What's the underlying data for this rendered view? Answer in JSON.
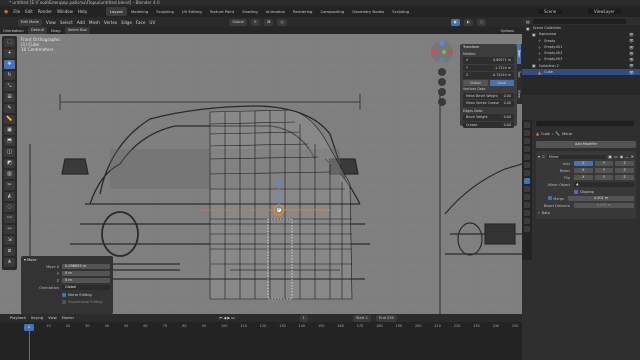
{
  "window": {
    "title": "* untitled [E:\\Гной\\Блендер работы\\Порш\\untitled.blend] - Blender 4.0"
  },
  "menubar": {
    "items": [
      "File",
      "Edit",
      "Render",
      "Window",
      "Help"
    ],
    "workspaces": [
      "Layout",
      "Modeling",
      "Sculpting",
      "UV Editing",
      "Texture Paint",
      "Shading",
      "Animation",
      "Rendering",
      "Compositing",
      "Geometry Nodes",
      "Scripting"
    ],
    "active_workspace": "Layout",
    "scene": "Scene",
    "view_layer": "ViewLayer"
  },
  "viewport_header": {
    "mode": "Edit Mode",
    "menus": [
      "View",
      "Select",
      "Add",
      "Mesh",
      "Vertex",
      "Edge",
      "Face",
      "UV"
    ],
    "transform_orientation": "Global",
    "orientation_label": "Orientation:",
    "orientation_value": "Default",
    "drag_label": "Drag:",
    "drag_value": "Select Box",
    "options": "Options"
  },
  "viewport": {
    "view_name": "Front Orthographic",
    "object_name": "(1) Cube",
    "units": "10 Centimeters"
  },
  "npanel": {
    "header": "Transform",
    "median": "Median:",
    "x_label": "X",
    "x_value": "0.80571 m",
    "y_label": "Y",
    "y_value": "-1.7224 m",
    "z_label": "Z",
    "z_value": "-0.74244 m",
    "global": "Global",
    "local": "Local",
    "vertices_data": "Vertices Data:",
    "mean_bevel_weight": "Mean Bevel Weight",
    "mean_bevel_weight_value": "0.00",
    "mean_vertex_crease": "Mean Vertex Crease",
    "mean_vertex_crease_value": "0.00",
    "edges_data": "Edges Data:",
    "bevel_weight": "Bevel Weight",
    "bevel_weight_value": "0.00",
    "crease": "Crease",
    "crease_value": "0.00",
    "tabs": [
      "Item",
      "Tool",
      "View"
    ]
  },
  "last_operator": {
    "title": "Move",
    "move_x_label": "Move X",
    "move_x_value": "0.098855 m",
    "y_label": "Y",
    "y_value": "0 m",
    "z_label": "Z",
    "z_value": "0 m",
    "orientation_label": "Orientation",
    "orientation_value": "Global",
    "mirror_editing": "Mirror Editing",
    "proportional_editing": "Proportional Editing"
  },
  "outliner": {
    "search_placeholder": "",
    "root": "Scene Collection",
    "items": [
      {
        "name": "Картинки",
        "indent": 1
      },
      {
        "name": "Empty",
        "indent": 2
      },
      {
        "name": "Empty.001",
        "indent": 2
      },
      {
        "name": "Empty.002",
        "indent": 2
      },
      {
        "name": "Empty.003",
        "indent": 2
      },
      {
        "name": "Collection 2",
        "indent": 1
      },
      {
        "name": "Cube",
        "indent": 2,
        "selected": true
      }
    ]
  },
  "properties": {
    "breadcrumb_object": "Cube",
    "breadcrumb_modifier": "Mirror",
    "add_modifier": "Add Modifier",
    "modifier_name": "Mirror",
    "axis_label": "Axis",
    "bisect_label": "Bisect",
    "flip_label": "Flip",
    "axes": [
      "X",
      "Y",
      "Z"
    ],
    "mirror_object_label": "Mirror Object",
    "clipping": "Clipping",
    "merge_label": "Merge",
    "merge_value": "0.001 m",
    "bisect_distance_label": "Bisect Distance",
    "bisect_distance_value": "0.001 m",
    "data_label": "Data"
  },
  "timeline": {
    "menus": [
      "Playback",
      "Keying",
      "View",
      "Marker"
    ],
    "current_frame": "1",
    "start_label": "Start",
    "start_value": "1",
    "end_label": "End",
    "end_value": "250",
    "ticks": [
      "0",
      "10",
      "20",
      "30",
      "40",
      "50",
      "60",
      "70",
      "80",
      "90",
      "100",
      "110",
      "120",
      "130",
      "140",
      "150",
      "160",
      "170",
      "180",
      "190",
      "200",
      "210",
      "220",
      "230",
      "240",
      "250"
    ]
  },
  "colors": {
    "accent": "#4772b3",
    "grid_bg": "#7f7f7f",
    "orange": "#e38a2e"
  }
}
